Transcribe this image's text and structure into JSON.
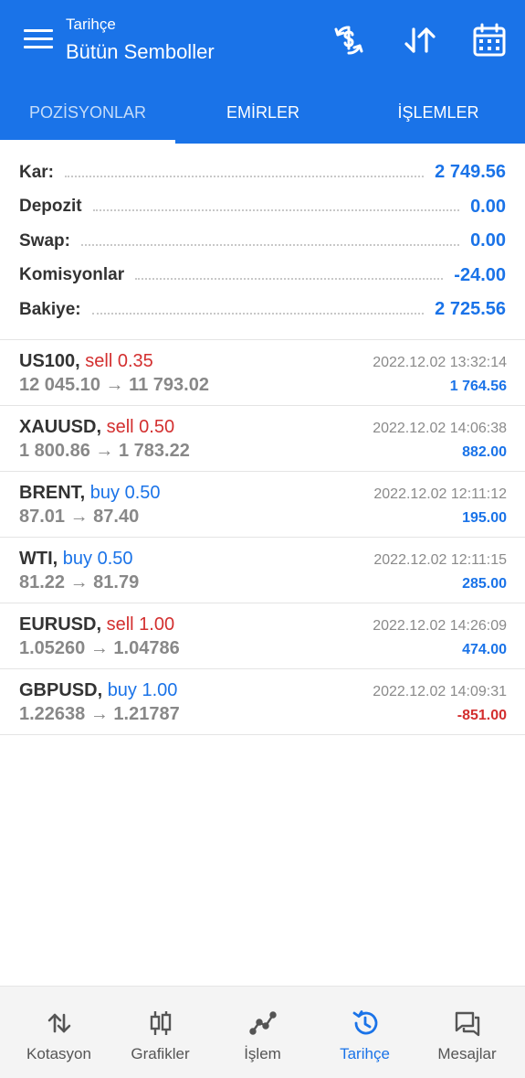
{
  "header": {
    "subtitle": "Tarihçe",
    "title": "Bütün Semboller",
    "icons": [
      "menu-icon",
      "currency-exchange-icon",
      "sort-icon",
      "calendar-icon"
    ],
    "color": "#1a73e8"
  },
  "tabs": [
    {
      "label": "POZİSYONLAR",
      "active": true
    },
    {
      "label": "EMİRLER",
      "active": false
    },
    {
      "label": "İŞLEMLER",
      "active": false
    }
  ],
  "summary": [
    {
      "label": "Kar:",
      "value": "2 749.56"
    },
    {
      "label": "Depozit",
      "value": "0.00"
    },
    {
      "label": "Swap:",
      "value": "0.00"
    },
    {
      "label": "Komisyonlar",
      "value": "-24.00"
    },
    {
      "label": "Bakiye:",
      "value": "2 725.56"
    }
  ],
  "deals": [
    {
      "symbol": "US100,",
      "side": "sell 0.35",
      "type": "sell",
      "price": "12 045.10 → 11 793.02",
      "time": "2022.12.02 13:32:14",
      "profit": "1 764.56",
      "profit_sign": "pos"
    },
    {
      "symbol": "XAUUSD,",
      "side": "sell 0.50",
      "type": "sell",
      "price": "1 800.86 → 1 783.22",
      "time": "2022.12.02 14:06:38",
      "profit": "882.00",
      "profit_sign": "pos"
    },
    {
      "symbol": "BRENT,",
      "side": "buy 0.50",
      "type": "buy",
      "price": "87.01 → 87.40",
      "time": "2022.12.02 12:11:12",
      "profit": "195.00",
      "profit_sign": "pos"
    },
    {
      "symbol": "WTI,",
      "side": "buy 0.50",
      "type": "buy",
      "price": "81.22 → 81.79",
      "time": "2022.12.02 12:11:15",
      "profit": "285.00",
      "profit_sign": "pos"
    },
    {
      "symbol": "EURUSD,",
      "side": "sell 1.00",
      "type": "sell",
      "price": "1.05260 → 1.04786",
      "time": "2022.12.02 14:26:09",
      "profit": "474.00",
      "profit_sign": "pos"
    },
    {
      "symbol": "GBPUSD,",
      "side": "buy 1.00",
      "type": "buy",
      "price": "1.22638 → 1.21787",
      "time": "2022.12.02 14:09:31",
      "profit": "-851.00",
      "profit_sign": "neg"
    }
  ],
  "bottom_nav": [
    {
      "label": "Kotasyon",
      "icon": "quotes-icon",
      "active": false
    },
    {
      "label": "Grafikler",
      "icon": "charts-icon",
      "active": false
    },
    {
      "label": "İşlem",
      "icon": "trade-icon",
      "active": false
    },
    {
      "label": "Tarihçe",
      "icon": "history-icon",
      "active": true
    },
    {
      "label": "Mesajlar",
      "icon": "messages-icon",
      "active": false
    }
  ],
  "colors": {
    "accent": "#1a73e8",
    "sell": "#d32f2f",
    "buy": "#1a73e8"
  }
}
